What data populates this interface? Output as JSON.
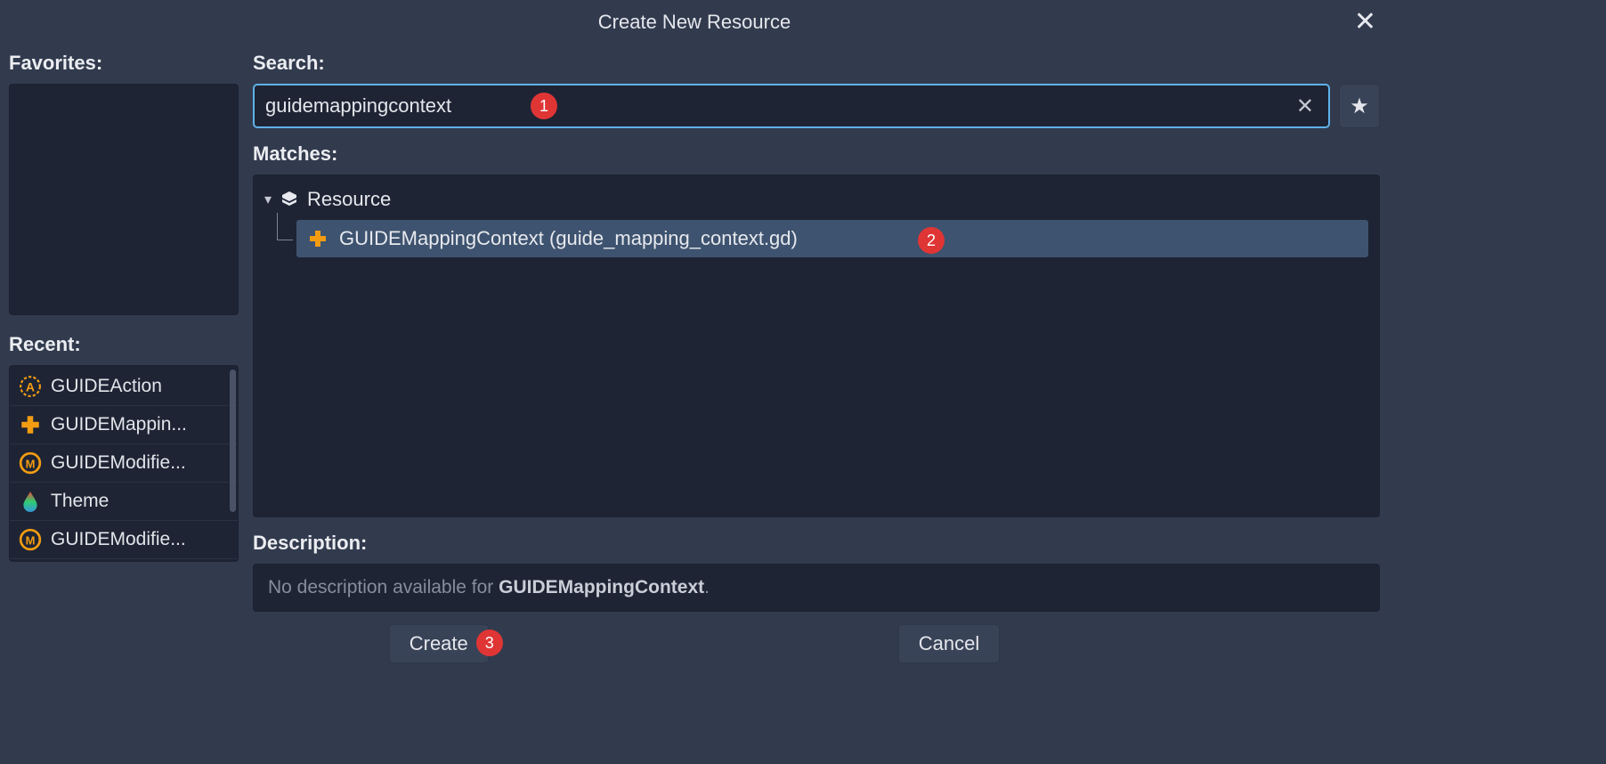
{
  "dialog": {
    "title": "Create New Resource"
  },
  "left": {
    "favorites_label": "Favorites:",
    "recent_label": "Recent:",
    "recent": [
      {
        "icon": "gear-a",
        "label": "GUIDEAction"
      },
      {
        "icon": "dpad",
        "label": "GUIDEMappin..."
      },
      {
        "icon": "ring-m",
        "label": "GUIDEModifie..."
      },
      {
        "icon": "drop",
        "label": "Theme"
      },
      {
        "icon": "ring-m",
        "label": "GUIDEModifie..."
      }
    ]
  },
  "search": {
    "label": "Search:",
    "value": "guidemappingcontext"
  },
  "matches": {
    "label": "Matches:",
    "root": "Resource",
    "selected": "GUIDEMappingContext (guide_mapping_context.gd)"
  },
  "description": {
    "label": "Description:",
    "prefix": "No description available for ",
    "class": "GUIDEMappingContext",
    "suffix": "."
  },
  "footer": {
    "create": "Create",
    "cancel": "Cancel"
  },
  "badges": {
    "b1": "1",
    "b2": "2",
    "b3": "3"
  }
}
